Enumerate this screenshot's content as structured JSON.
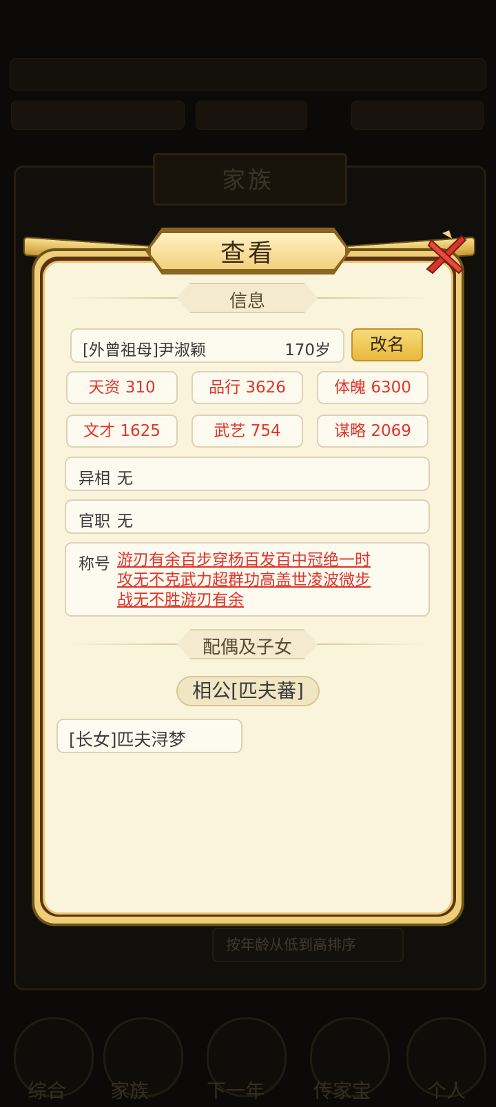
{
  "background": {
    "dialog_title": "家族",
    "sort_label": "按年龄从低到高排序",
    "nav_items": [
      "综合",
      "家族",
      "下一年",
      "传家宝",
      "个人"
    ]
  },
  "dialog": {
    "title": "查看",
    "info_section": "信息",
    "person": {
      "name": "[外曾祖母]尹淑颖",
      "age": "170岁",
      "rename_label": "改名"
    },
    "stats": [
      {
        "label": "天资 310"
      },
      {
        "label": "品行 3626"
      },
      {
        "label": "体魄 6300"
      },
      {
        "label": "文才 1625"
      },
      {
        "label": "武艺 754"
      },
      {
        "label": "谋略 2069"
      }
    ],
    "yixiang": {
      "label": "异相",
      "value": "无"
    },
    "guanzhi": {
      "label": "官职",
      "value": "无"
    },
    "chenghao": {
      "label": "称号",
      "lines": [
        "游刃有余百步穿杨百发百中冠绝一时",
        "攻无不克武力超群功高盖世凌波微步",
        "战无不胜游刃有余"
      ]
    },
    "family_section": "配偶及子女",
    "spouse": "相公[匹夫蕃]",
    "children": [
      "[长女]匹夫浔梦"
    ]
  },
  "colors": {
    "panel_bg": "#fbf4dc",
    "stat_red": "#e0352a",
    "gold": "#efce79"
  }
}
